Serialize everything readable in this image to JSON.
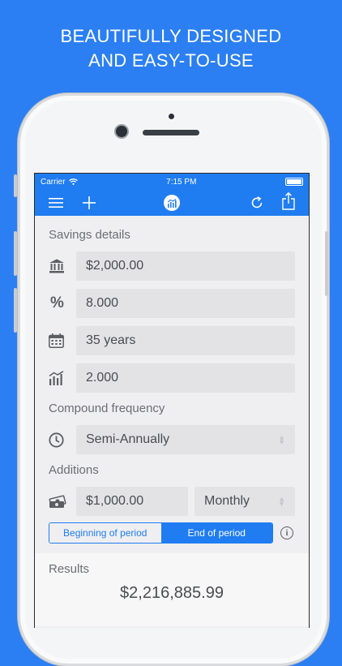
{
  "headline": {
    "line1": "BEAUTIFULLY DESIGNED",
    "line2": "AND EASY-TO-USE"
  },
  "status_bar": {
    "carrier": "Carrier",
    "time": "7:15 PM"
  },
  "navbar": {
    "icons": [
      "menu-icon",
      "add-icon",
      "chart-logo-icon",
      "refresh-icon",
      "share-icon"
    ]
  },
  "savings_details": {
    "label": "Savings details",
    "principal": "$2,000.00",
    "interest_rate": "8.000",
    "duration": "35 years",
    "rate_variation": "2.000"
  },
  "compound_frequency": {
    "label": "Compound frequency",
    "value": "Semi-Annually"
  },
  "additions": {
    "label": "Additions",
    "amount": "$1,000.00",
    "frequency": "Monthly",
    "timing_options": [
      "Beginning of period",
      "End of period"
    ],
    "selected_timing": "End of period"
  },
  "results": {
    "label": "Results",
    "value": "$2,216,885.99"
  },
  "colors": {
    "brand_blue": "#1f7cf1",
    "background_blue": "#2b7ff3"
  }
}
